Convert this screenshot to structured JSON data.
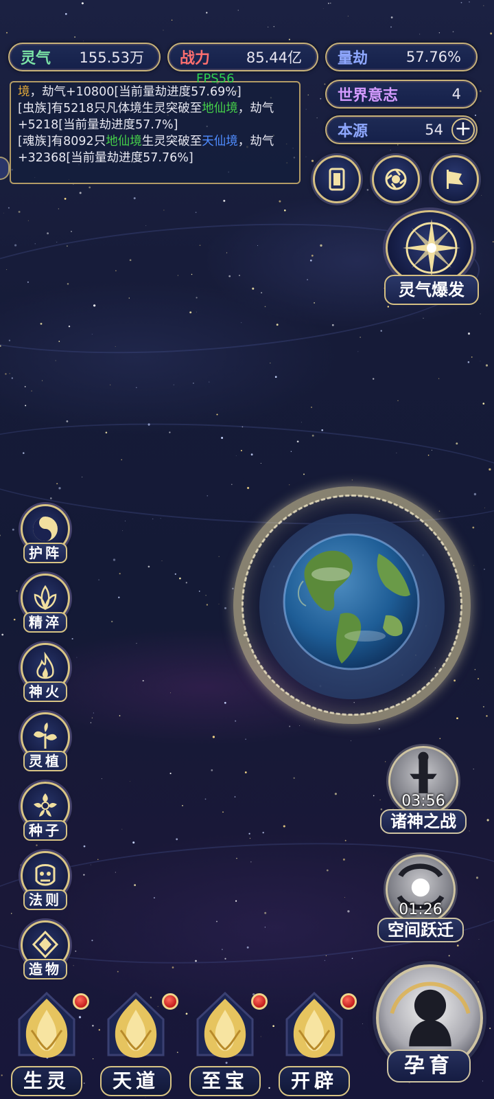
{
  "stats": {
    "lingqi": {
      "label": "灵气",
      "value": "155.53万",
      "color": "#7be3a6"
    },
    "zhanli": {
      "label": "战力",
      "value": "85.44亿",
      "color": "#ff6f6f"
    },
    "liangjie": {
      "label": "量劫",
      "value": "57.76%",
      "color": "#8fa8ff"
    },
    "shijie": {
      "label": "世界意志",
      "value": "4",
      "color": "#d49bff"
    },
    "benyuan": {
      "label": "本源",
      "value": "54",
      "color": "#8fa8ff"
    }
  },
  "fps": "FPS56",
  "log": [
    [
      {
        "t": "境",
        "c": "#e2a93a"
      },
      {
        "t": "，劫气+10800[当前量劫进度57.69%]",
        "c": "#e9e9f2"
      }
    ],
    [
      {
        "t": "[虫族]有5218只凡体境生灵突破至",
        "c": "#e9e9f2"
      },
      {
        "t": "地仙境",
        "c": "#45d04a"
      },
      {
        "t": "，劫气+5218[当前量劫进度57.7%]",
        "c": "#e9e9f2"
      }
    ],
    [
      {
        "t": "[魂族]",
        "c": "#e9e9f2"
      },
      {
        "t": "有8092只",
        "c": "#e9e9f2"
      },
      {
        "t": "地仙境",
        "c": "#45d04a"
      },
      {
        "t": "生灵突破至",
        "c": "#e9e9f2"
      },
      {
        "t": "天仙境",
        "c": "#4f8cff"
      },
      {
        "t": "，劫气+32368[当前量劫进度57.76%]",
        "c": "#e9e9f2"
      }
    ]
  ],
  "burst": {
    "label": "灵气爆发"
  },
  "left_menu": [
    {
      "label": "护阵",
      "icon": "yin-yang-icon"
    },
    {
      "label": "精淬",
      "icon": "lotus-icon"
    },
    {
      "label": "神火",
      "icon": "flame-icon"
    },
    {
      "label": "灵植",
      "icon": "plant-icon"
    },
    {
      "label": "种子",
      "icon": "flower-icon"
    },
    {
      "label": "法则",
      "icon": "rune-icon"
    },
    {
      "label": "造物",
      "icon": "diamond-icon"
    }
  ],
  "events": [
    {
      "label": "诸神之战",
      "time": "03:56"
    },
    {
      "label": "空间跃迁",
      "time": "01:26"
    }
  ],
  "bottom_nav": [
    {
      "label": "生灵",
      "badge": true
    },
    {
      "label": "天道",
      "badge": true
    },
    {
      "label": "至宝",
      "badge": true
    },
    {
      "label": "开辟",
      "badge": true
    }
  ],
  "main_action": {
    "label": "孕育"
  }
}
